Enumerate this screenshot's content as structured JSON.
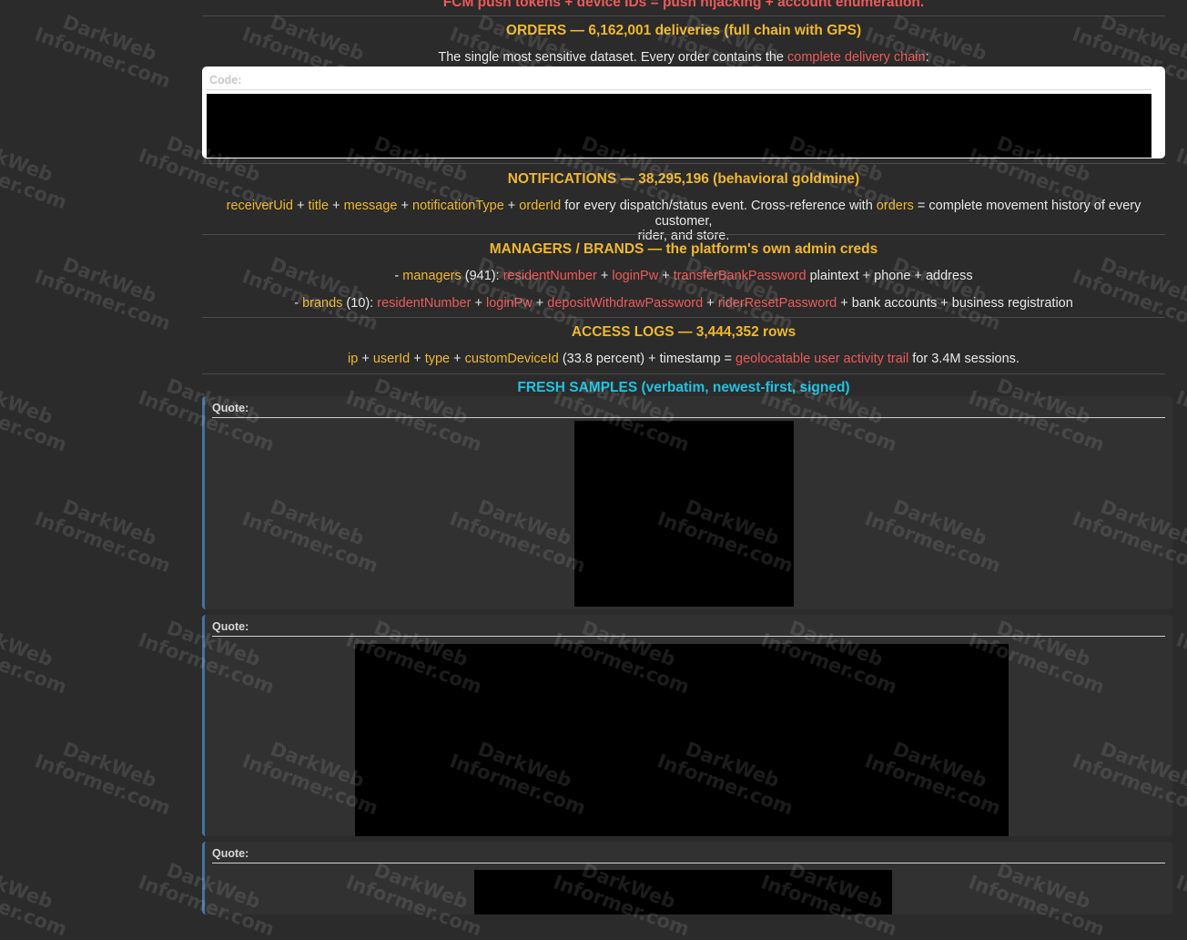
{
  "top_line": "FCM push tokens + device IDs = push hijacking + account enumeration.",
  "orders": {
    "heading": "ORDERS — 6,162,001 deliveries (full chain with GPS)",
    "intro_text": "The single most sensitive dataset. Every order contains the ",
    "intro_link": "complete delivery chain",
    "intro_end": ":"
  },
  "code_label": "Code:",
  "notifications": {
    "heading": "NOTIFICATIONS — 38,295,196 (behavioral goldmine)",
    "f1": "receiverUid",
    "plus1": " + ",
    "f2": "title",
    "plus2": " + ",
    "f3": "message",
    "plus3": " + ",
    "f4": "notificationType",
    "plus4": " + ",
    "f5": "orderId",
    "mid": " for every dispatch/status event. Cross-reference with ",
    "f6": "orders",
    "tail1": " = complete movement history of every customer,",
    "tail2": "rider, and store."
  },
  "managers": {
    "heading": "MANAGERS / BRANDS — the platform's own admin creds",
    "l1": {
      "dash": "- ",
      "name": "managers",
      "count": " (941): ",
      "a": "residentNumber",
      "p1": " + ",
      "b": "loginPw",
      "p2": " + ",
      "c": "transferBankPassword",
      "rest": " plaintext + phone + address"
    },
    "l2": {
      "dash": "- ",
      "name": "brands",
      "count": " (10): ",
      "a": "residentNumber",
      "p1": " + ",
      "b": "loginPw",
      "p2": " + ",
      "c": "depositWithdrawPassword",
      "p3": " + ",
      "d": "riderResetPassword",
      "rest": " + bank accounts + business registration"
    }
  },
  "access_logs": {
    "heading": "ACCESS LOGS — 3,444,352 rows",
    "f1": "ip",
    "p1": " + ",
    "f2": "userId",
    "p2": " + ",
    "f3": "type",
    "p3": " + ",
    "f4": "customDeviceId",
    "mid": " (33.8 percent) + timestamp = ",
    "f5": "geolocatable user activity trail",
    "end": " for 3.4M sessions."
  },
  "fresh_samples": {
    "heading": "FRESH SAMPLES (verbatim, newest-first, signed)"
  },
  "quote_label": "Quote:",
  "watermark": {
    "line1": "DarkWeb",
    "line2": "Informer.com"
  },
  "colors": {
    "background": "#2b2b2b",
    "field": "#f0b82e",
    "sensitive": "#ee5959",
    "accent": "#1ec3e3",
    "quote_border": "#3f75a7"
  }
}
